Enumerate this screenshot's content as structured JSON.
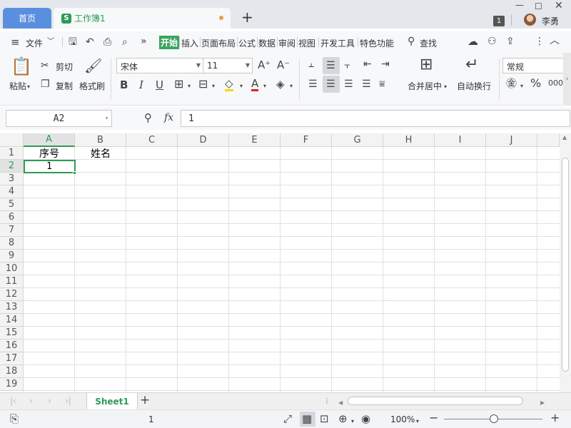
{
  "tabs": {
    "home": "首页",
    "doc_icon": "S",
    "doc_name": "工作簿1",
    "new_tab": "+"
  },
  "window": {
    "badge": "1",
    "user": "李勇"
  },
  "menu": {
    "file": "文件",
    "items": [
      "开始",
      "插入",
      "页面布局",
      "公式",
      "数据",
      "审阅",
      "视图",
      "开发工具",
      "特色功能"
    ],
    "search": "查找"
  },
  "ribbon": {
    "paste": "粘贴",
    "cut": "剪切",
    "copy": "复制",
    "format_painter": "格式刷",
    "font_name": "宋体",
    "font_size": "11",
    "merge_center": "合并居中",
    "wrap_text": "自动换行",
    "number_format": "常规"
  },
  "formula_bar": {
    "cell_ref": "A2",
    "fx": "fx",
    "value": "1"
  },
  "sheet": {
    "columns": [
      "A",
      "B",
      "C",
      "D",
      "E",
      "F",
      "G",
      "H",
      "I",
      "J"
    ],
    "rows": [
      "1",
      "2",
      "3",
      "4",
      "5",
      "6",
      "7",
      "8",
      "9",
      "10",
      "11",
      "12",
      "13",
      "14",
      "15",
      "16",
      "17",
      "18",
      "19"
    ],
    "cells": {
      "A1": "序号",
      "B1": "姓名",
      "A2": "1"
    },
    "selected": "A2"
  },
  "sheet_tabs": {
    "active": "Sheet1",
    "add": "+"
  },
  "status": {
    "page": "1",
    "zoom": "100%"
  },
  "colors": {
    "accent_green": "#2e9b57",
    "home_tab_blue": "#5a8fe0",
    "active_menu": "#3aa560"
  }
}
